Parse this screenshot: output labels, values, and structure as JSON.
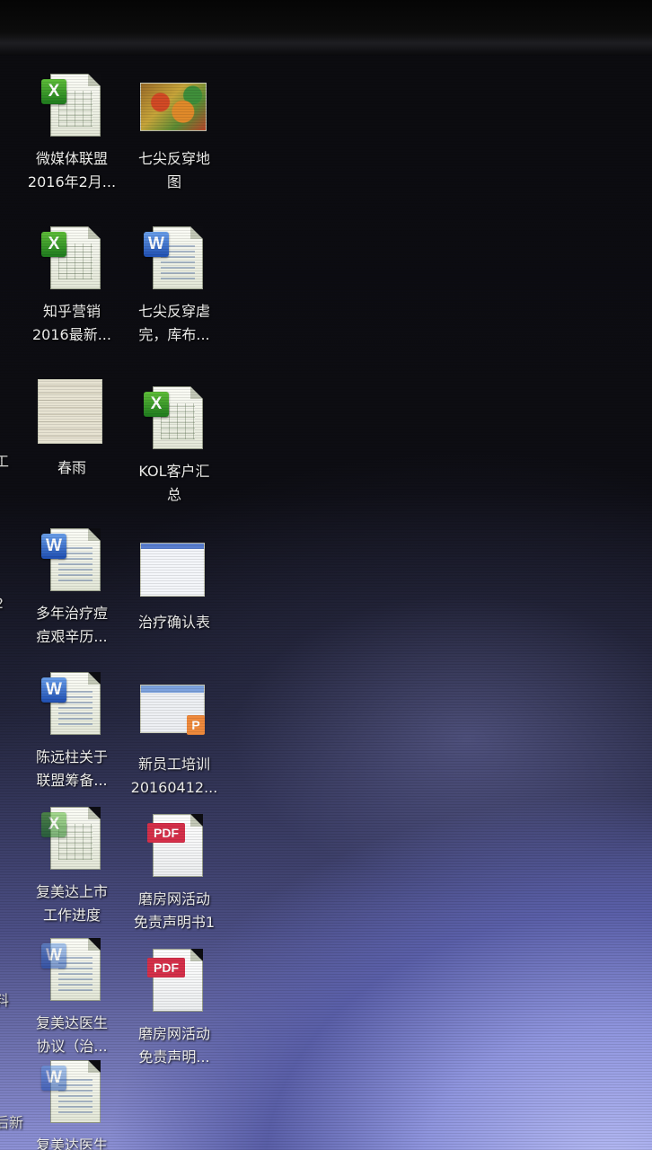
{
  "desktop": {
    "icons": [
      {
        "id": "xlsx1",
        "label": "微媒体联盟\n2016年2月...",
        "type": "excel"
      },
      {
        "id": "map1",
        "label": "七尖反穿地\n图",
        "type": "image-map"
      },
      {
        "id": "xlsx2",
        "label": "知乎营销\n2016最新...",
        "type": "excel"
      },
      {
        "id": "docx1",
        "label": "七尖反穿虐\n完，库布...",
        "type": "word"
      },
      {
        "id": "img1",
        "label": "春雨",
        "type": "image"
      },
      {
        "id": "xlsx3",
        "label": "KOL客户汇\n总",
        "type": "excel"
      },
      {
        "id": "docx2",
        "label": "多年治疗痘\n痘艰辛历...",
        "type": "word"
      },
      {
        "id": "img2",
        "label": "治疗确认表",
        "type": "image-form"
      },
      {
        "id": "docx3",
        "label": "陈远柱关于\n联盟筹备...",
        "type": "word"
      },
      {
        "id": "ppt1",
        "label": "新员工培训\n20160412...",
        "type": "powerpoint"
      },
      {
        "id": "xlsx4",
        "label": "复美达上市\n工作进度",
        "type": "excel"
      },
      {
        "id": "pdf1",
        "label": "磨房网活动\n免责声明书1",
        "type": "pdf"
      },
      {
        "id": "docx4",
        "label": "复美达医生\n协议（治...",
        "type": "word"
      },
      {
        "id": "pdf2",
        "label": "磨房网活动\n免责声明...",
        "type": "pdf"
      },
      {
        "id": "docx5",
        "label": "复美达医生\n协议（转...",
        "type": "word"
      }
    ],
    "edge_fragments": [
      "工",
      "2",
      "料",
      "后新"
    ]
  },
  "icon_badges": {
    "excel": "X",
    "word": "W",
    "pdf": "PDF",
    "powerpoint": "P"
  }
}
